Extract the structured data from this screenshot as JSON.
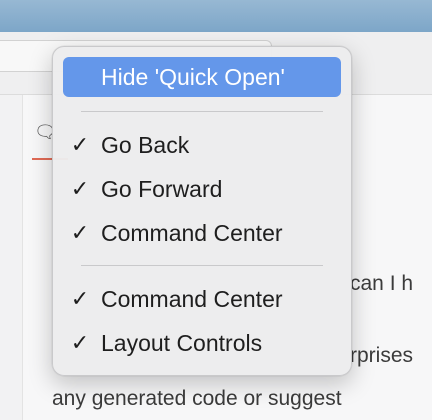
{
  "background": {
    "text_line_1": "can I h",
    "text_line_2": "rprises",
    "text_line_3": "any generated code or suggest"
  },
  "context_menu": {
    "items": [
      {
        "label": "Hide 'Quick Open'",
        "checked": false,
        "highlighted": true
      },
      {
        "label": "Go Back",
        "checked": true
      },
      {
        "label": "Go Forward",
        "checked": true
      },
      {
        "label": "Command Center",
        "checked": true
      },
      {
        "label": "Command Center",
        "checked": true
      },
      {
        "label": "Layout Controls",
        "checked": true
      }
    ],
    "check_glyph": "✓"
  },
  "colors": {
    "highlight": "#6497ea",
    "tab_underline": "#e06a55"
  },
  "icons": {
    "chat": "chat-bubble-icon"
  }
}
